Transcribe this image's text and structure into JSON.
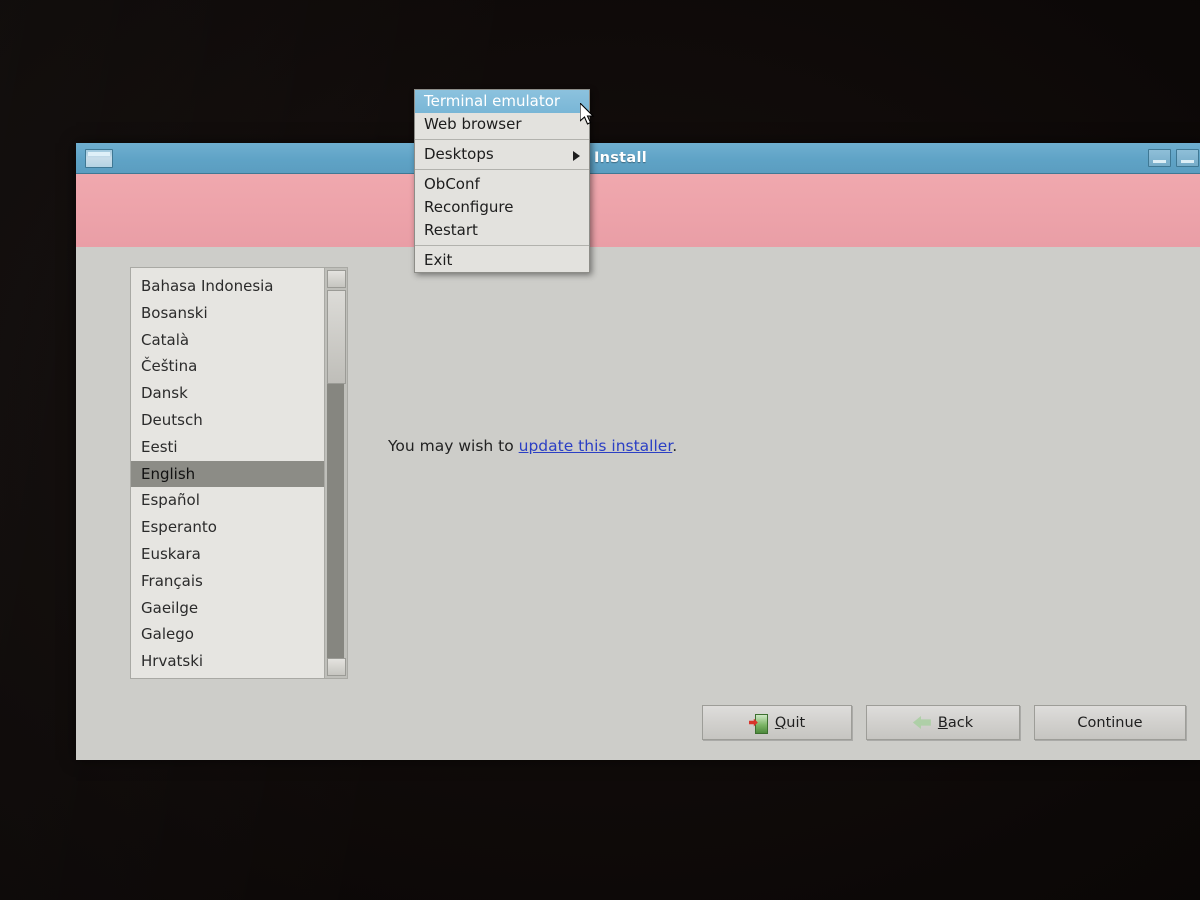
{
  "window": {
    "title": "Install",
    "icon": "window-icon",
    "controls": [
      "minimize-button",
      "maximize-button"
    ]
  },
  "main": {
    "notice_prefix": "You may wish to ",
    "notice_link": "update this installer",
    "notice_suffix": "."
  },
  "language_list": {
    "selected": "English",
    "items": [
      "Bahasa Indonesia",
      "Bosanski",
      "Català",
      "Čeština",
      "Dansk",
      "Deutsch",
      "Eesti",
      "English",
      "Español",
      "Esperanto",
      "Euskara",
      "Français",
      "Gaeilge",
      "Galego",
      "Hrvatski"
    ]
  },
  "buttons": {
    "quit": "Quit",
    "quit_icon": "exit-door-icon",
    "back": "Back",
    "back_icon": "left-arrow-icon",
    "continue": "Continue"
  },
  "root_menu": {
    "highlighted": "Terminal emulator",
    "items": [
      {
        "label": "Terminal emulator",
        "highlighted": true,
        "submenu": false,
        "separator_after": false
      },
      {
        "label": "Web browser",
        "highlighted": false,
        "submenu": false,
        "separator_after": true
      },
      {
        "label": "Desktops",
        "highlighted": false,
        "submenu": true,
        "separator_after": true
      },
      {
        "label": "ObConf",
        "highlighted": false,
        "submenu": false,
        "separator_after": false
      },
      {
        "label": "Reconfigure",
        "highlighted": false,
        "submenu": false,
        "separator_after": false
      },
      {
        "label": "Restart",
        "highlighted": false,
        "submenu": false,
        "separator_after": true
      },
      {
        "label": "Exit",
        "highlighted": false,
        "submenu": false,
        "separator_after": false
      }
    ]
  },
  "colors": {
    "titlebar": "#5fa3c6",
    "banner": "#eda3aa",
    "window_body": "#cdcdc9",
    "menu_highlight": "#79b6d6",
    "list_selection": "#8c8c86",
    "link": "#2b3fc4"
  }
}
